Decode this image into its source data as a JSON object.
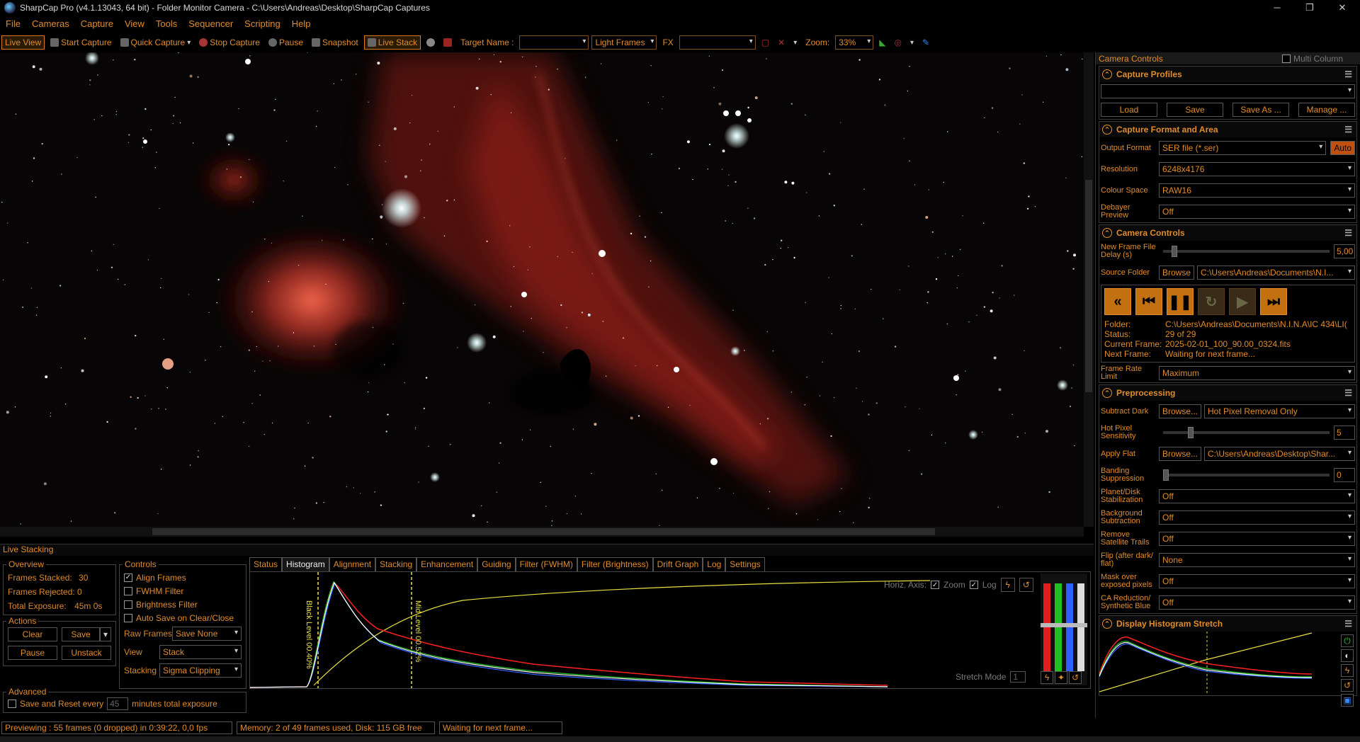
{
  "window": {
    "title": "SharpCap Pro (v4.1.13043, 64 bit) - Folder Monitor Camera - C:\\Users\\Andreas\\Desktop\\SharpCap Captures",
    "minimize": "─",
    "maximize": "❐",
    "close": "✕"
  },
  "menu": [
    "File",
    "Cameras",
    "Capture",
    "View",
    "Tools",
    "Sequencer",
    "Scripting",
    "Help"
  ],
  "toolbar": {
    "live_view": "Live View",
    "start_capture": "Start Capture",
    "quick_capture": "Quick Capture",
    "stop_capture": "Stop Capture",
    "pause": "Pause",
    "snapshot": "Snapshot",
    "live_stack": "Live Stack",
    "target_name_label": "Target Name :",
    "target_name_value": "",
    "frame_type": "Light Frames",
    "fx_label": "FX",
    "fx_value": "",
    "zoom_label": "Zoom:",
    "zoom_value": "33%"
  },
  "right_panel": {
    "header": "Camera Controls",
    "multi_column": "Multi Column",
    "capture_profiles": {
      "title": "Capture Profiles",
      "profile": "",
      "load": "Load",
      "save": "Save",
      "save_as": "Save As ...",
      "manage": "Manage ..."
    },
    "capture_format": {
      "title": "Capture Format and Area",
      "output_format_label": "Output Format",
      "output_format": "SER file (*.ser)",
      "auto": "Auto",
      "resolution_label": "Resolution",
      "resolution": "6248x4176",
      "colour_space_label": "Colour Space",
      "colour_space": "RAW16",
      "debayer_label": "Debayer Preview",
      "debayer": "Off"
    },
    "camera_controls": {
      "title": "Camera Controls",
      "delay_label": "New Frame File Delay (s)",
      "delay_value": "5,00",
      "delay_level": 0.05,
      "source_folder_label": "Source Folder",
      "browse": "Browse",
      "source_folder": "C:\\Users\\Andreas\\Documents\\N.I...",
      "folder_label": "Folder:",
      "folder": "C:\\Users\\Andreas\\Documents\\N.I.N.A\\IC 434\\LI(",
      "status_label": "Status:",
      "status": "29 of 29",
      "current_label": "Current Frame:",
      "current": "2025-02-01_100_90.00_0324.fits",
      "next_label": "Next Frame:",
      "next": "Waiting for next frame...",
      "frame_rate_label": "Frame Rate Limit",
      "frame_rate": "Maximum"
    },
    "preprocessing": {
      "title": "Preprocessing",
      "subtract_dark_label": "Subtract Dark",
      "browse": "Browse...",
      "subtract_dark": "Hot Pixel Removal Only",
      "hot_pixel_label": "Hot Pixel Sensitivity",
      "hot_pixel_value": "5",
      "hot_pixel_level": 0.15,
      "apply_flat_label": "Apply Flat",
      "apply_flat": "C:\\Users\\Andreas\\Desktop\\Shar...",
      "banding_label": "Banding Suppression",
      "banding_value": "0",
      "banding_level": 0.0,
      "planet_label": "Planet/Disk Stabilization",
      "planet": "Off",
      "background_label": "Background Subtraction",
      "background": "Off",
      "satellite_label": "Remove Satellite Trails",
      "satellite": "Off",
      "flip_label": "Flip (after dark/ flat)",
      "flip": "None",
      "mask_label": "Mask over exposed pixels",
      "mask": "Off",
      "ca_label": "CA Reduction/ Synthetic Blue",
      "ca": "Off"
    },
    "display_stretch": {
      "title": "Display Histogram Stretch"
    }
  },
  "live_stacking": {
    "title": "Live Stacking",
    "overview": {
      "title": "Overview",
      "stacked_label": "Frames Stacked:",
      "stacked": "30",
      "rejected_label": "Frames Rejected:",
      "rejected": "0",
      "exposure_label": "Total Exposure:",
      "exposure": "45m 0s"
    },
    "actions": {
      "title": "Actions",
      "clear": "Clear",
      "save": "Save",
      "pause": "Pause",
      "unstack": "Unstack"
    },
    "advanced": {
      "title": "Advanced",
      "save_reset": "Save and Reset every",
      "minutes_value": "45",
      "minutes_label": "minutes total exposure"
    },
    "controls": {
      "title": "Controls",
      "align": "Align Frames",
      "fwhm": "FWHM Filter",
      "brightness": "Brightness Filter",
      "autosave": "Auto Save on Clear/Close",
      "raw_frames_label": "Raw Frames",
      "raw_frames": "Save None",
      "view_label": "View",
      "view": "Stack",
      "stacking_label": "Stacking",
      "stacking": "Sigma Clipping"
    },
    "tabs": [
      "Status",
      "Histogram",
      "Alignment",
      "Stacking",
      "Enhancement",
      "Guiding",
      "Filter (FWHM)",
      "Filter (Brightness)",
      "Drift Graph",
      "Log",
      "Settings"
    ],
    "active_tab": "Histogram",
    "histogram": {
      "horiz_axis": "Horiz. Axis:",
      "zoom": "Zoom",
      "log": "Log",
      "black_level": "Black Level 00.40%",
      "mid_level": "Mid Level 00.52%",
      "stretch_mode": "Stretch Mode",
      "stretch_value": "1"
    }
  },
  "status": {
    "previewing": "Previewing : 55 frames (0 dropped) in 0:39:22, 0,0 fps",
    "memory": "Memory: 2 of 49 frames used, Disk: 115 GB free",
    "waiting": "Waiting for next frame..."
  },
  "colors": {
    "accent": "#e08c2a",
    "red": "#ff2020",
    "green": "#20c020",
    "blue": "#3060ff",
    "yellow": "#e8e040"
  }
}
